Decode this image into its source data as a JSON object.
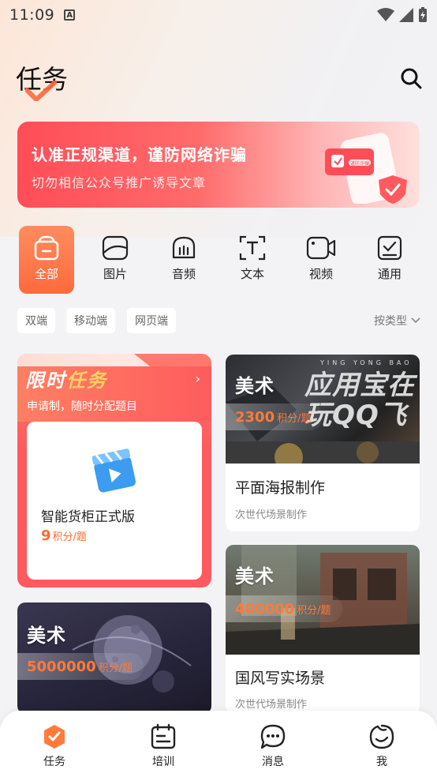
{
  "status_bar": {
    "time": "11:09",
    "notif_icon": "a-notification-icon"
  },
  "header": {
    "title": "任务"
  },
  "banner": {
    "title": "认准正规渠道，谨防网络诈骗",
    "subtitle": "切勿相信公众号推广诱导文章",
    "phone_badge": "谨防诈骗",
    "colors": {
      "start": "#ff4d57",
      "end": "#ffe0dc"
    }
  },
  "categories": [
    {
      "label": "全部",
      "icon": "all-icon",
      "active": true
    },
    {
      "label": "图片",
      "icon": "image-icon",
      "active": false
    },
    {
      "label": "音频",
      "icon": "audio-icon",
      "active": false
    },
    {
      "label": "文本",
      "icon": "text-icon",
      "active": false
    },
    {
      "label": "视频",
      "icon": "video-icon",
      "active": false
    },
    {
      "label": "通用",
      "icon": "general-icon",
      "active": false
    }
  ],
  "filters": {
    "chips": [
      "双端",
      "移动端",
      "网页端"
    ],
    "sort_label": "按类型"
  },
  "limited_task": {
    "title_a": "限时",
    "title_b": "任务",
    "subtitle": "申请制，随时分配题目",
    "item": {
      "name": "智能货柜正式版",
      "points": "9",
      "unit": "积分/题"
    }
  },
  "tasks": [
    {
      "tag": "美术",
      "points": "2300",
      "unit": "积分/题",
      "title": "平面海报制作",
      "sub": "次世代场景制作",
      "overlay_text": "应用宝在 玩QQ飞",
      "overlay_small": "YING YONG BAO"
    },
    {
      "tag": "美术",
      "points": "400000",
      "unit": "积分/题",
      "title": "国风写实场景",
      "sub": "次世代场景制作"
    },
    {
      "tag": "美术",
      "points": "5000000",
      "unit": "积分/题"
    }
  ],
  "bottom_nav": [
    {
      "label": "任务",
      "icon": "task-icon",
      "active": true
    },
    {
      "label": "培训",
      "icon": "training-icon",
      "active": false
    },
    {
      "label": "消息",
      "icon": "message-icon",
      "active": false
    },
    {
      "label": "我",
      "icon": "profile-icon",
      "active": false
    }
  ],
  "accent": "#ff6a3d"
}
